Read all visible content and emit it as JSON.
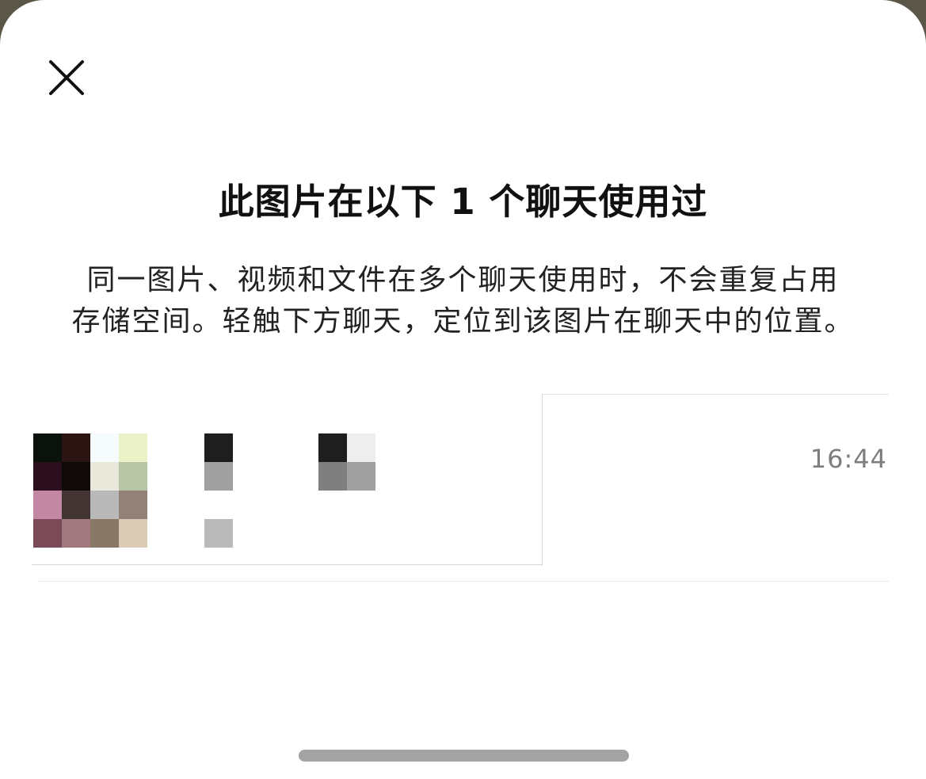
{
  "dialog": {
    "close_icon": "close-icon",
    "title": "此图片在以下 1 个聊天使用过",
    "description_line1": "同一图片、视频和文件在多个聊天使用时，不会重复占用",
    "description_line2": "存储空间。轻触下方聊天，定位到该图片在聊天中的位置。"
  },
  "chat_list": [
    {
      "time": "16:44",
      "avatar_colors": [
        "#0b120b",
        "#2b1412",
        "#f6fcfd",
        "#eaf1c7",
        "#2b0f1d",
        "#0f0a08",
        "#e9e8da",
        "#b8c6a7",
        "#c387a3",
        "#433434",
        "#b9b9b9",
        "#928177",
        "#7a4b56",
        "#a0797f",
        "#877867",
        "#d9cbb5"
      ],
      "name_colors": {
        "a": "#1e1e1e",
        "b": "#a0a0a0",
        "c": "#bababa",
        "d": "#1e1e1e",
        "e": "#eeeeee",
        "f": "#7f7f7f",
        "g": "#a0a0a0"
      }
    }
  ],
  "colors": {
    "background": "#ffffff",
    "title": "#111111",
    "text": "#222222",
    "time": "#7d7d7d",
    "home_indicator": "#a3a3a3"
  }
}
